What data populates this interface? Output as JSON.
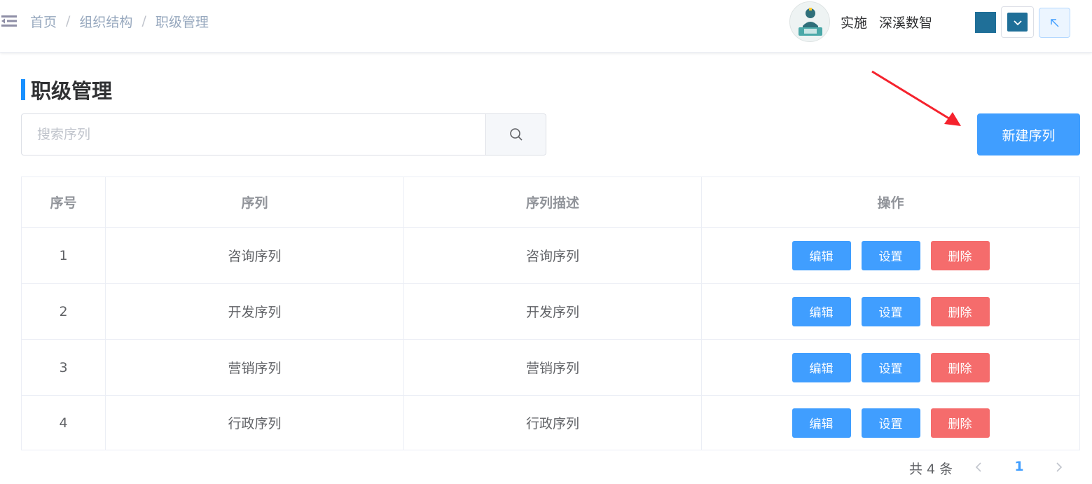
{
  "header": {
    "breadcrumb": [
      "首页",
      "组织结构",
      "职级管理"
    ],
    "breadcrumb_separator": "/",
    "user_role": "实施",
    "company": "深溪数智",
    "theme_color": "#1f6f98"
  },
  "page": {
    "title": "职级管理",
    "search_placeholder": "搜索序列",
    "new_button": "新建序列"
  },
  "table": {
    "columns": [
      "序号",
      "序列",
      "序列描述",
      "操作"
    ],
    "rows": [
      {
        "index": "1",
        "sequence": "咨询序列",
        "description": "咨询序列"
      },
      {
        "index": "2",
        "sequence": "开发序列",
        "description": "开发序列"
      },
      {
        "index": "3",
        "sequence": "营销序列",
        "description": "营销序列"
      },
      {
        "index": "4",
        "sequence": "行政序列",
        "description": "行政序列"
      }
    ],
    "actions": {
      "edit": "编辑",
      "settings": "设置",
      "delete": "删除"
    }
  },
  "pagination": {
    "total_text": "共 4 条",
    "current_page": "1"
  },
  "colors": {
    "primary": "#409eff",
    "danger": "#f56c6c",
    "annotation_arrow": "#f5222d"
  }
}
